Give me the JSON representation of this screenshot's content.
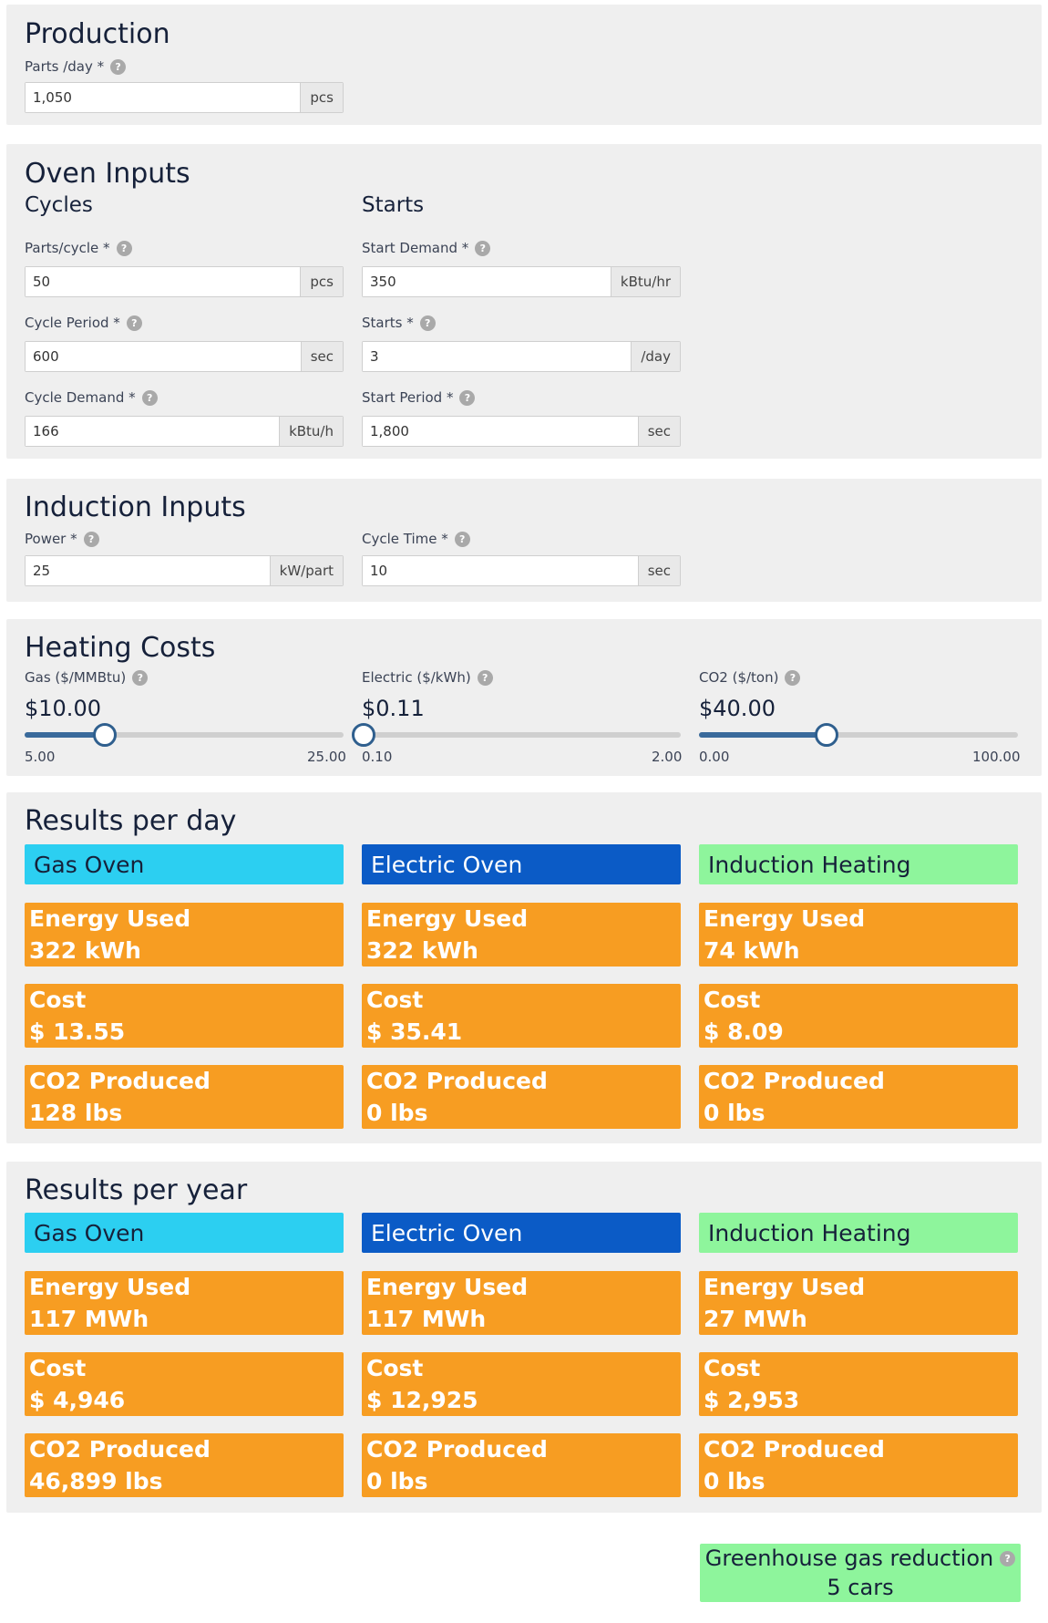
{
  "production": {
    "title": "Production",
    "parts_label": "Parts /day *",
    "parts_value": "1,050",
    "parts_unit": "pcs"
  },
  "oven": {
    "title": "Oven Inputs",
    "cycles_title": "Cycles",
    "starts_title": "Starts",
    "parts_cycle_label": "Parts/cycle *",
    "parts_cycle_value": "50",
    "parts_cycle_unit": "pcs",
    "cycle_period_label": "Cycle Period *",
    "cycle_period_value": "600",
    "cycle_period_unit": "sec",
    "cycle_demand_label": "Cycle Demand *",
    "cycle_demand_value": "166",
    "cycle_demand_unit": "kBtu/h",
    "start_demand_label": "Start Demand *",
    "start_demand_value": "350",
    "start_demand_unit": "kBtu/hr",
    "starts_label": "Starts *",
    "starts_value": "3",
    "starts_unit": "/day",
    "start_period_label": "Start Period *",
    "start_period_value": "1,800",
    "start_period_unit": "sec"
  },
  "induction": {
    "title": "Induction Inputs",
    "power_label": "Power *",
    "power_value": "25",
    "power_unit": "kW/part",
    "cycle_time_label": "Cycle Time *",
    "cycle_time_value": "10",
    "cycle_time_unit": "sec"
  },
  "heating": {
    "title": "Heating Costs",
    "sliders": [
      {
        "label": "Gas ($/MMBtu)",
        "display": "$10.00",
        "min_label": "5.00",
        "max_label": "25.00",
        "min": 5,
        "max": 25,
        "value": 10
      },
      {
        "label": "Electric ($/kWh)",
        "display": "$0.11",
        "min_label": "0.10",
        "max_label": "2.00",
        "min": 0.1,
        "max": 2,
        "value": 0.11
      },
      {
        "label": "CO2 ($/ton)",
        "display": "$40.00",
        "min_label": "0.00",
        "max_label": "100.00",
        "min": 0,
        "max": 100,
        "value": 40
      }
    ]
  },
  "columns": [
    "Gas Oven",
    "Electric Oven",
    "Induction Heating"
  ],
  "colors": {
    "gas": "#2ccff1",
    "electric": "#0b5bc6",
    "induction": "#8ef59c",
    "card": "#f79d22",
    "slider": "#2f5f8e"
  },
  "help_glyph": "?",
  "results_day": {
    "title": "Results per day",
    "energy_label": "Energy Used",
    "cost_label": "Cost",
    "co2_label": "CO2 Produced",
    "energy": [
      "322 kWh",
      "322 kWh",
      "74 kWh"
    ],
    "cost": [
      "$ 13.55",
      "$ 35.41",
      "$ 8.09"
    ],
    "co2": [
      "128 lbs",
      "0 lbs",
      "0 lbs"
    ]
  },
  "results_year": {
    "title": "Results per year",
    "energy_label": "Energy Used",
    "cost_label": "Cost",
    "co2_label": "CO2 Produced",
    "energy": [
      "117 MWh",
      "117 MWh",
      "27 MWh"
    ],
    "cost": [
      "$ 4,946",
      "$ 12,925",
      "$ 2,953"
    ],
    "co2": [
      "46,899 lbs",
      "0 lbs",
      "0 lbs"
    ]
  },
  "ghg": {
    "label": "Greenhouse gas reduction",
    "value": "5 cars"
  }
}
